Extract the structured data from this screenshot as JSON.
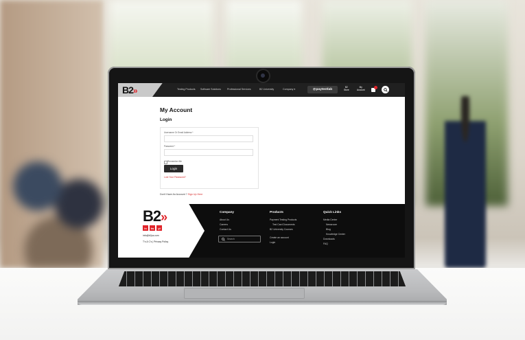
{
  "header": {
    "logo": "B2",
    "logo_chevron": "»",
    "nav_links": [
      "Testing Products",
      "Software Solutions",
      "Professional Services",
      "B2 University",
      "Company"
    ],
    "company_caret": "▾",
    "paytest_label": "@paytestlab",
    "store_label": "B2\nStore",
    "account_label": "My\nAccount",
    "search_icon": "search-icon"
  },
  "page": {
    "title": "My Account",
    "section_title": "Login"
  },
  "login_form": {
    "username_label": "Username Or Email Address *",
    "username_value": "",
    "password_label": "Password *",
    "password_value": "",
    "remember_label": "Remember Me",
    "login_button": "Login",
    "lost_password": "Lost Your Password?"
  },
  "signup_prompt": {
    "text": "Don't Have An Account ?",
    "link": "Sign Up Here"
  },
  "footer": {
    "logo": "B2",
    "logo_chevron": "»",
    "socials": [
      "in",
      "tw",
      "yt"
    ],
    "email": "info@b2ps.com",
    "terms": "T's & C's | Privacy Policy",
    "company": {
      "heading": "Company",
      "items": [
        "About Us",
        "Careers",
        "Contact Us"
      ]
    },
    "search_placeholder": "Search",
    "products": {
      "heading": "Products",
      "items": [
        "Payment Testing Products",
        "Test Card Documents",
        "B2 University Courses",
        "Create an account",
        "Login"
      ]
    },
    "quick_links": {
      "heading": "Quick Links",
      "items": [
        "Media Center",
        "Newsroom",
        "Blog",
        "Knowledge Center",
        "Downloads",
        "FAQ"
      ]
    }
  },
  "colors": {
    "brand_red": "#e0242a",
    "nav_dark": "#202020",
    "footer_bg": "#0d0d0d"
  }
}
